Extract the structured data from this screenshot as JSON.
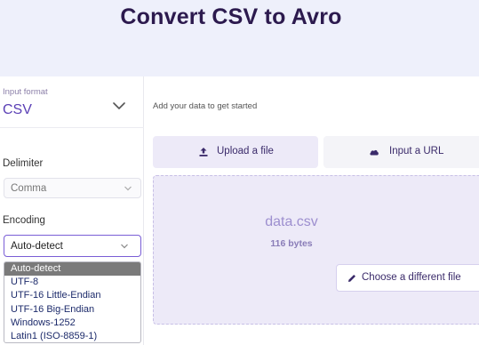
{
  "header": {
    "title": "Convert CSV to Avro"
  },
  "input_format": {
    "label": "Input format",
    "value": "CSV"
  },
  "delimiter": {
    "label": "Delimiter",
    "value": "Comma"
  },
  "encoding": {
    "label": "Encoding",
    "value": "Auto-detect",
    "options": [
      "Auto-detect",
      "UTF-8",
      "UTF-16 Little-Endian",
      "UTF-16 Big-Endian",
      "Windows-1252",
      "Latin1 (ISO-8859-1)"
    ],
    "highlighted_option": "Auto-detect"
  },
  "main": {
    "prompt": "Add your data to get started",
    "tabs": {
      "upload": {
        "label": "Upload a file",
        "icon": "upload-icon"
      },
      "url": {
        "label": "Input a URL",
        "icon": "cloud-icon"
      }
    },
    "file": {
      "name": "data.csv",
      "size": "116 bytes"
    },
    "choose_button": {
      "label": "Choose a different file",
      "icon": "pencil-icon"
    }
  },
  "colors": {
    "accent": "#5a3fb5",
    "header_bg": "#eef0fb",
    "panel_tint": "#edeaf8",
    "title": "#2c1a4e"
  }
}
